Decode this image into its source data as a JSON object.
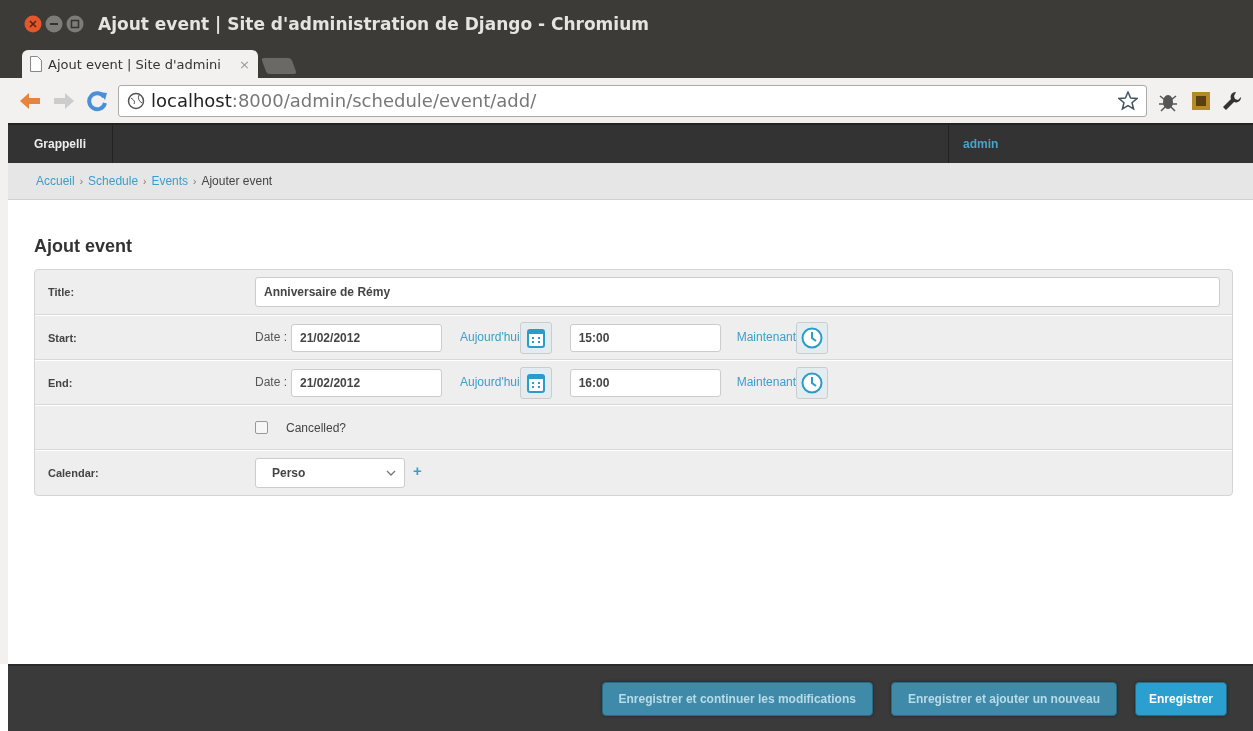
{
  "window": {
    "title": "Ajout event | Site d'administration de Django - Chromium"
  },
  "tabs": [
    {
      "label": "Ajout event | Site d'admini",
      "close": "×",
      "selected": true
    }
  ],
  "address_bar": {
    "host": "localhost",
    "path": ":8000/admin/schedule/event/add/"
  },
  "header": {
    "brand": "Grappelli",
    "user": "admin"
  },
  "breadcrumbs": [
    {
      "label": "Accueil",
      "kind": "link"
    },
    {
      "label": "›",
      "kind": "separator"
    },
    {
      "label": "Schedule",
      "kind": "link"
    },
    {
      "label": "›",
      "kind": "separator"
    },
    {
      "label": "Events",
      "kind": "link"
    },
    {
      "label": "›",
      "kind": "separator"
    },
    {
      "label": "Ajouter event",
      "kind": "current"
    }
  ],
  "page_title": "Ajout event",
  "form": {
    "rows": [
      {
        "kind": "text",
        "label": "Title:",
        "value": "Anniversaire de Rémy"
      },
      {
        "kind": "datetime",
        "label": "Start:",
        "date_label": "Date :",
        "date": "21/02/2012",
        "today": "Aujourd'hui",
        "time": "15:00",
        "now": "Maintenant"
      },
      {
        "kind": "datetime",
        "label": "End:",
        "date_label": "Date :",
        "date": "21/02/2012",
        "today": "Aujourd'hui",
        "time": "16:00",
        "now": "Maintenant"
      },
      {
        "kind": "checkbox",
        "label": "Cancelled?",
        "checked": false
      },
      {
        "kind": "select",
        "label": "Calendar:",
        "value": "Perso",
        "add": "+"
      }
    ]
  },
  "actions": [
    {
      "label": "Enregistrer et continuer les modifications",
      "primary": false
    },
    {
      "label": "Enregistrer et ajouter un nouveau",
      "primary": false
    },
    {
      "label": "Enregistrer",
      "primary": true
    }
  ]
}
